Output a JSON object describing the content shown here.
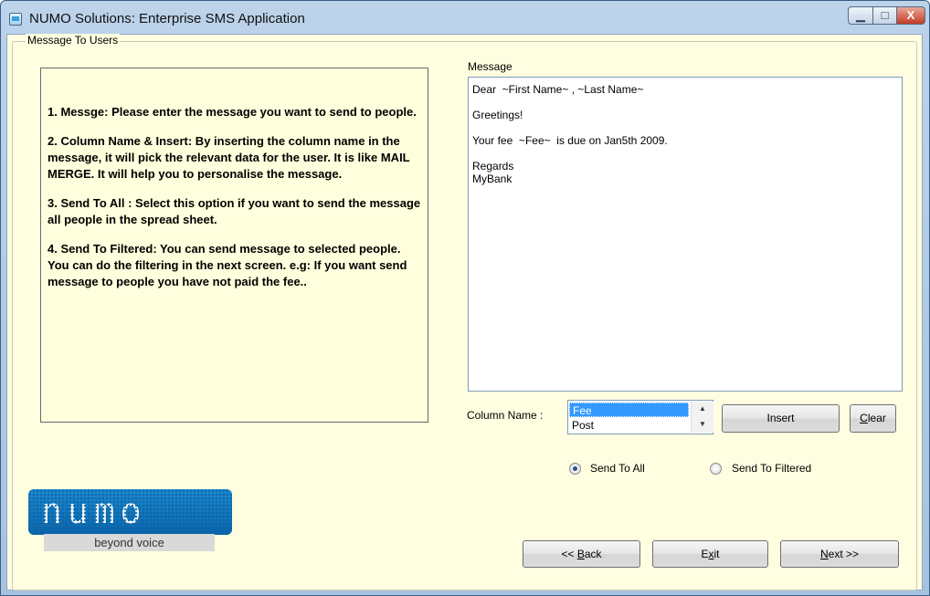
{
  "window": {
    "title": "NUMO Solutions: Enterprise SMS Application",
    "minimize_glyph": "▁",
    "maximize_glyph": "□",
    "close_glyph": "X"
  },
  "group": {
    "legend": "Message To Users"
  },
  "instructions": [
    "1. Messge: Please enter the message you want to send to people.",
    "2. Column Name & Insert: By inserting the column name in the message, it will pick the relevant data for the user. It is like MAIL MERGE. It will help you to personalise the message.",
    "3. Send To All : Select this option if you want to send the message all people in the spread sheet.",
    "4. Send To Filtered: You can send message to selected people. You can do the filtering in the next screen. e.g: If you want send message to people you have not paid the fee.."
  ],
  "message": {
    "label": "Message",
    "value": "Dear  ~First Name~ , ~Last Name~\n\nGreetings!\n\nYour fee  ~Fee~  is due on Jan5th 2009.\n\nRegards\nMyBank"
  },
  "column": {
    "label": "Column Name :",
    "items": [
      "Fee",
      "Post"
    ],
    "selected_index": 0
  },
  "buttons": {
    "insert": "Insert",
    "clear_access": "C",
    "clear_rest": "lear",
    "back_prefix": "<< ",
    "back_access": "B",
    "back_rest": "ack",
    "exit_pre": "E",
    "exit_access": "x",
    "exit_rest": "it",
    "next_access": "N",
    "next_rest": "ext >>"
  },
  "send_mode": {
    "all_label": "Send To All",
    "filtered_label": "Send To Filtered",
    "selected": "all"
  },
  "logo": {
    "wordmark": "numo",
    "tagline": "beyond voice",
    "color": "#0a64a8"
  }
}
